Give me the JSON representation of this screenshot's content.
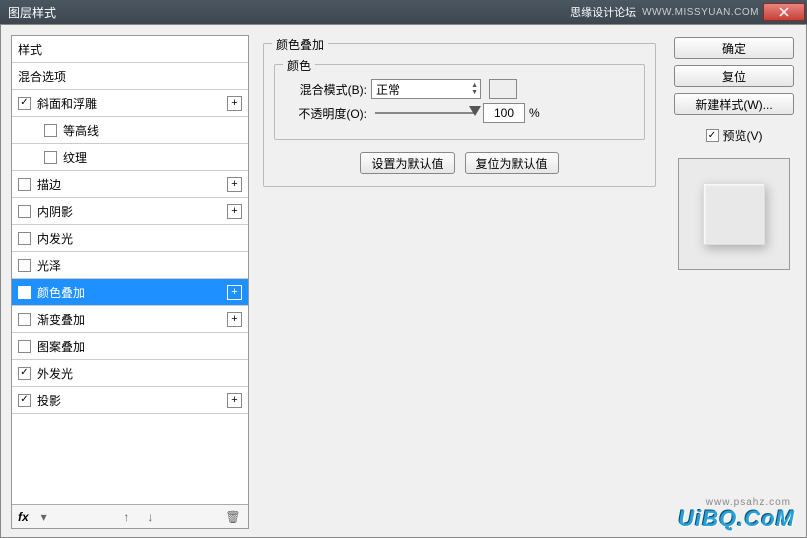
{
  "window": {
    "title": "图层样式",
    "forum": "思缘设计论坛",
    "url": "WWW.MISSYUAN.COM"
  },
  "sidebar": {
    "items": [
      {
        "label": "样式",
        "checkbox": false,
        "checked": false,
        "indent": false,
        "plus": false
      },
      {
        "label": "混合选项",
        "checkbox": false,
        "checked": false,
        "indent": false,
        "plus": false
      },
      {
        "label": "斜面和浮雕",
        "checkbox": true,
        "checked": true,
        "indent": false,
        "plus": true
      },
      {
        "label": "等高线",
        "checkbox": true,
        "checked": false,
        "indent": true,
        "plus": false
      },
      {
        "label": "纹理",
        "checkbox": true,
        "checked": false,
        "indent": true,
        "plus": false
      },
      {
        "label": "描边",
        "checkbox": true,
        "checked": false,
        "indent": false,
        "plus": true
      },
      {
        "label": "内阴影",
        "checkbox": true,
        "checked": false,
        "indent": false,
        "plus": true
      },
      {
        "label": "内发光",
        "checkbox": true,
        "checked": false,
        "indent": false,
        "plus": false
      },
      {
        "label": "光泽",
        "checkbox": true,
        "checked": false,
        "indent": false,
        "plus": false
      },
      {
        "label": "颜色叠加",
        "checkbox": true,
        "checked": true,
        "indent": false,
        "plus": true,
        "selected": true
      },
      {
        "label": "渐变叠加",
        "checkbox": true,
        "checked": false,
        "indent": false,
        "plus": true
      },
      {
        "label": "图案叠加",
        "checkbox": true,
        "checked": false,
        "indent": false,
        "plus": false
      },
      {
        "label": "外发光",
        "checkbox": true,
        "checked": true,
        "indent": false,
        "plus": false
      },
      {
        "label": "投影",
        "checkbox": true,
        "checked": true,
        "indent": false,
        "plus": true
      }
    ],
    "footer_fx": "fx"
  },
  "center": {
    "section_title": "颜色叠加",
    "color_group": "颜色",
    "blend_mode_label": "混合模式(B):",
    "blend_mode_value": "正常",
    "opacity_label": "不透明度(O):",
    "opacity_value": "100",
    "opacity_unit": "%",
    "set_default": "设置为默认值",
    "reset_default": "复位为默认值"
  },
  "right": {
    "ok": "确定",
    "cancel": "复位",
    "new_style": "新建样式(W)...",
    "preview": "预览(V)"
  },
  "watermark": "UiBQ.CoM",
  "watermark2": "www.psahz.com"
}
